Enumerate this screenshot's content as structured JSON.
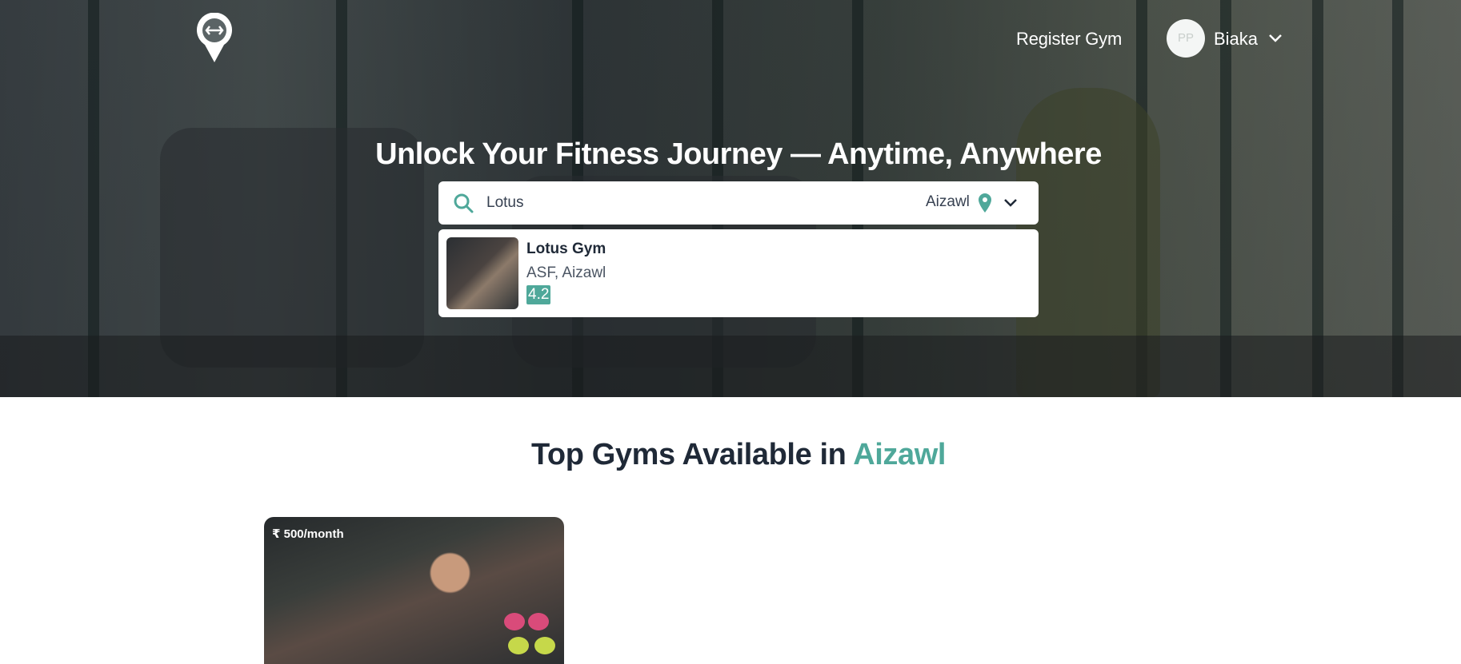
{
  "header": {
    "logo_icon": "dumbbell-pin-icon",
    "register_label": "Register Gym",
    "avatar_alt": "PP",
    "username": "Biaka"
  },
  "hero": {
    "headline": "Unlock Your Fitness Journey — Anytime, Anywhere"
  },
  "search": {
    "value": "Lotus",
    "city": "Aizawl",
    "icons": [
      "search-icon",
      "map-pin-icon",
      "chevron-down-icon"
    ]
  },
  "results": [
    {
      "name": "Lotus Gym",
      "address": "ASF, Aizawl",
      "rating": "4.2"
    }
  ],
  "section": {
    "title_prefix": "Top Gyms Available in ",
    "title_city": "Aizawl"
  },
  "gyms": [
    {
      "price": "₹ 500/month"
    }
  ],
  "colors": {
    "accent": "#4fa89a",
    "text_dark": "#1f2937",
    "white": "#ffffff"
  }
}
